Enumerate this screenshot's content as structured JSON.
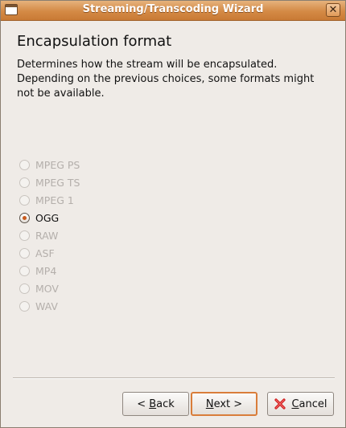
{
  "window": {
    "title": "Streaming/Transcoding Wizard",
    "close_glyph": "✕"
  },
  "page": {
    "heading": "Encapsulation format",
    "description_lines": [
      "Determines how the stream will be encapsulated.",
      "Depending on the previous choices, some formats might",
      "not be available."
    ]
  },
  "formats": [
    {
      "label": "MPEG PS",
      "checked": false,
      "enabled": false
    },
    {
      "label": "MPEG TS",
      "checked": false,
      "enabled": false
    },
    {
      "label": "MPEG 1",
      "checked": false,
      "enabled": false
    },
    {
      "label": "OGG",
      "checked": true,
      "enabled": true
    },
    {
      "label": "RAW",
      "checked": false,
      "enabled": false
    },
    {
      "label": "ASF",
      "checked": false,
      "enabled": false
    },
    {
      "label": "MP4",
      "checked": false,
      "enabled": false
    },
    {
      "label": "MOV",
      "checked": false,
      "enabled": false
    },
    {
      "label": "WAV",
      "checked": false,
      "enabled": false
    }
  ],
  "buttons": {
    "back": {
      "pre": "< ",
      "mnemonic": "B",
      "post": "ack"
    },
    "next": {
      "pre": "",
      "mnemonic": "N",
      "post": "ext >"
    },
    "cancel": {
      "pre": "",
      "mnemonic": "C",
      "post": "ancel",
      "icon": "cancel-x-icon"
    }
  },
  "colors": {
    "accent": "#d48a45",
    "selected_dot": "#c95a1d",
    "cancel_icon": "#d01818"
  }
}
